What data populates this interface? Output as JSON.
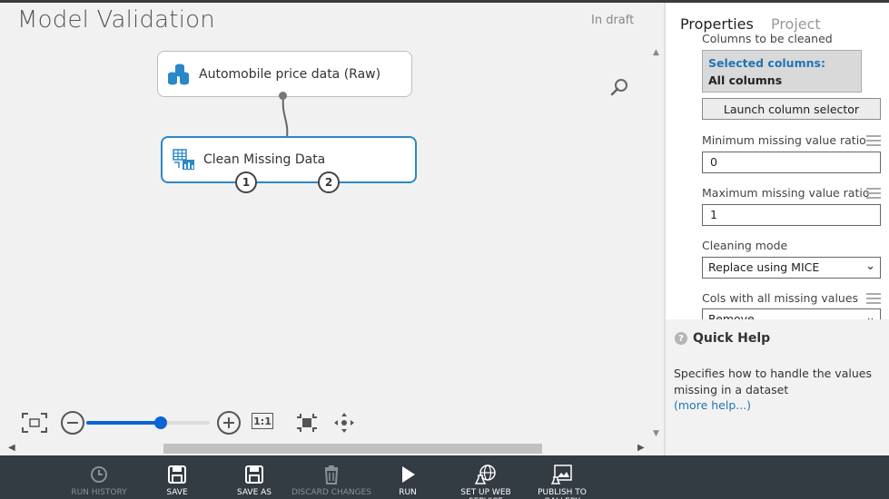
{
  "experiment": {
    "title": "Model Validation",
    "status": "In draft"
  },
  "modules": {
    "raw": {
      "label": "Automobile price data (Raw)"
    },
    "clean": {
      "label": "Clean Missing Data",
      "port1": "1",
      "port2": "2"
    }
  },
  "zoom": {
    "one_to_one_label": "1:1",
    "level_fraction": 0.6
  },
  "panel": {
    "tab_properties": "Properties",
    "tab_project": "Project",
    "columns_label": "Columns to be cleaned",
    "selected_title": "Selected columns:",
    "selected_value": "All columns",
    "launch_button": "Launch column selector",
    "min_label": "Minimum missing value ratio",
    "min_value": "0",
    "max_label": "Maximum missing value ratio",
    "max_value": "1",
    "mode_label": "Cleaning mode",
    "mode_value": "Replace using MICE",
    "cols_label": "Cols with all missing values",
    "cols_value": "Remove"
  },
  "quick_help": {
    "title": "Quick Help",
    "text": "Specifies how to handle the values missing in a dataset",
    "more_link": "(more help...)"
  },
  "toolbar": {
    "run_history": "RUN HISTORY",
    "save": "SAVE",
    "save_as": "SAVE AS",
    "discard": "DISCARD CHANGES",
    "run": "RUN",
    "setup_web": "SET UP WEB SERVICE",
    "publish": "PUBLISH TO GALLERY"
  },
  "icons": {
    "search": "magnifier-icon",
    "dataset": "dataset-icon",
    "clean_module": "clean-data-icon"
  },
  "colors": {
    "accent": "#2b88c8",
    "slider": "#0a64d6",
    "toolbar_bg": "#333b43",
    "link": "#2175b5"
  }
}
